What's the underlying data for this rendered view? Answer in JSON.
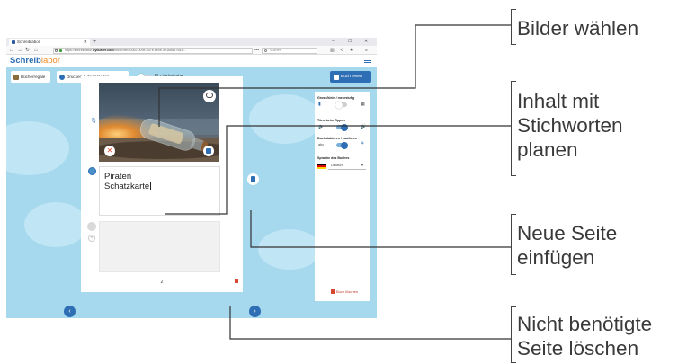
{
  "browser": {
    "tab_title": "Schreiblabor",
    "tab_plus": "+",
    "window_controls": [
      "−",
      "☐",
      "✕"
    ],
    "nav_icons": [
      "back-icon",
      "forward-icon",
      "reload-icon",
      "home-icon"
    ],
    "url_prefix": "https://schreiblabor.",
    "url_domain": "dybuster.com",
    "url_suffix": "/book/9eb30082-009e-447e-be0e-5e1688874d3r...",
    "url_more": "•••",
    "search_placeholder": "Suchen",
    "toolbar_icons": [
      "library-icon",
      "sync-icon",
      "extension-icon",
      "menu-icon"
    ]
  },
  "app": {
    "logo_main": "Schreib",
    "logo_accent": "labor",
    "menu_icon": "hamburger-icon"
  },
  "toolbar": {
    "shelf_label": "Bücherregale",
    "print_label": "Drucken & downloaden",
    "share_label": "Linkfreigabe",
    "read_label": "Buch lesen"
  },
  "editor": {
    "text": "Piraten\nSchatzkarte",
    "page_number": "2",
    "image_alt": "Flaschenpost am Strand"
  },
  "sidepanel": {
    "case_label": "Gross/klein / mehrstufig",
    "tone_label": "Töne beim Tippen",
    "letters_label": "Buchstabieren / Lautieren",
    "letters_abc": "abc",
    "language_label": "Sprache des Buches",
    "language_value": "Deutsch",
    "delete_label": "Buch löschen"
  },
  "callouts": {
    "choose_images": "Bilder wählen",
    "plan_content": "Inhalt mit\nStichworten\nplanen",
    "insert_page": "Neue Seite\neinfügen",
    "delete_page": "Nicht benötigte\nSeite löschen"
  },
  "colors": {
    "brand_blue": "#2e6eb4",
    "brand_orange": "#f08a24",
    "stage_bg": "#a6d9ee",
    "danger_red": "#d64530"
  }
}
